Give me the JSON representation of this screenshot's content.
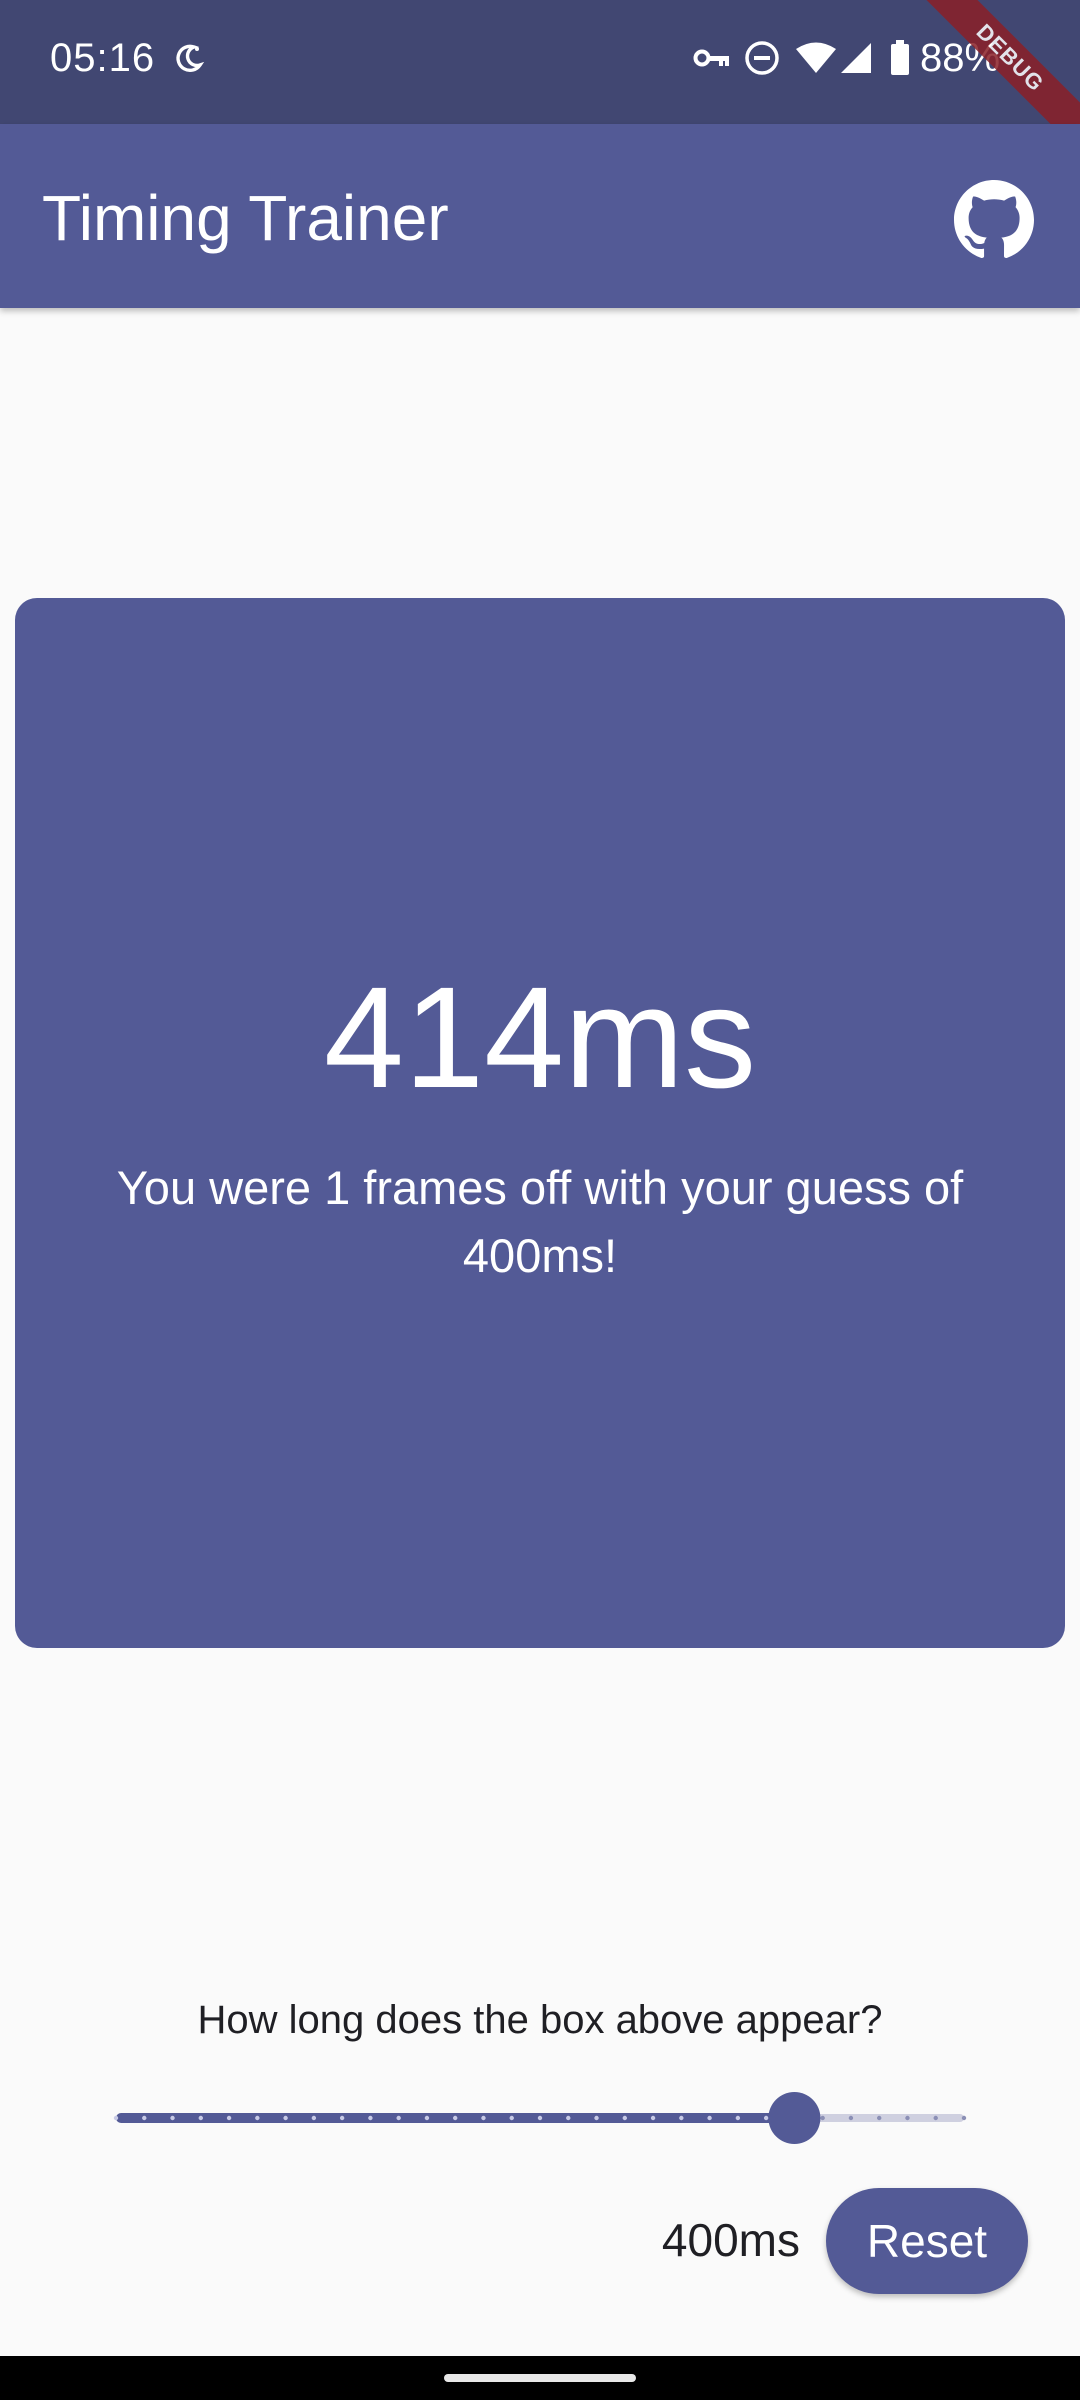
{
  "status_bar": {
    "time": "05:16",
    "battery": "88%",
    "icons": [
      "do-not-disturb-moon-icon",
      "vpn-key-icon",
      "dnd-icon",
      "wifi-icon",
      "signal-icon",
      "battery-icon"
    ]
  },
  "debug_label": "DEBUG",
  "app_bar": {
    "title": "Timing Trainer",
    "action_icon": "github-icon"
  },
  "result": {
    "ms": "414ms",
    "message": "You were 1 frames off with your guess of 400ms!"
  },
  "controls": {
    "question": "How long does the box above appear?",
    "slider_value_fraction": 0.8,
    "value_label": "400ms",
    "reset_label": "Reset"
  },
  "colors": {
    "primary": "#535a96",
    "status_bar": "#414772",
    "background": "#fafafa",
    "debug_ribbon": "#8a2027"
  }
}
